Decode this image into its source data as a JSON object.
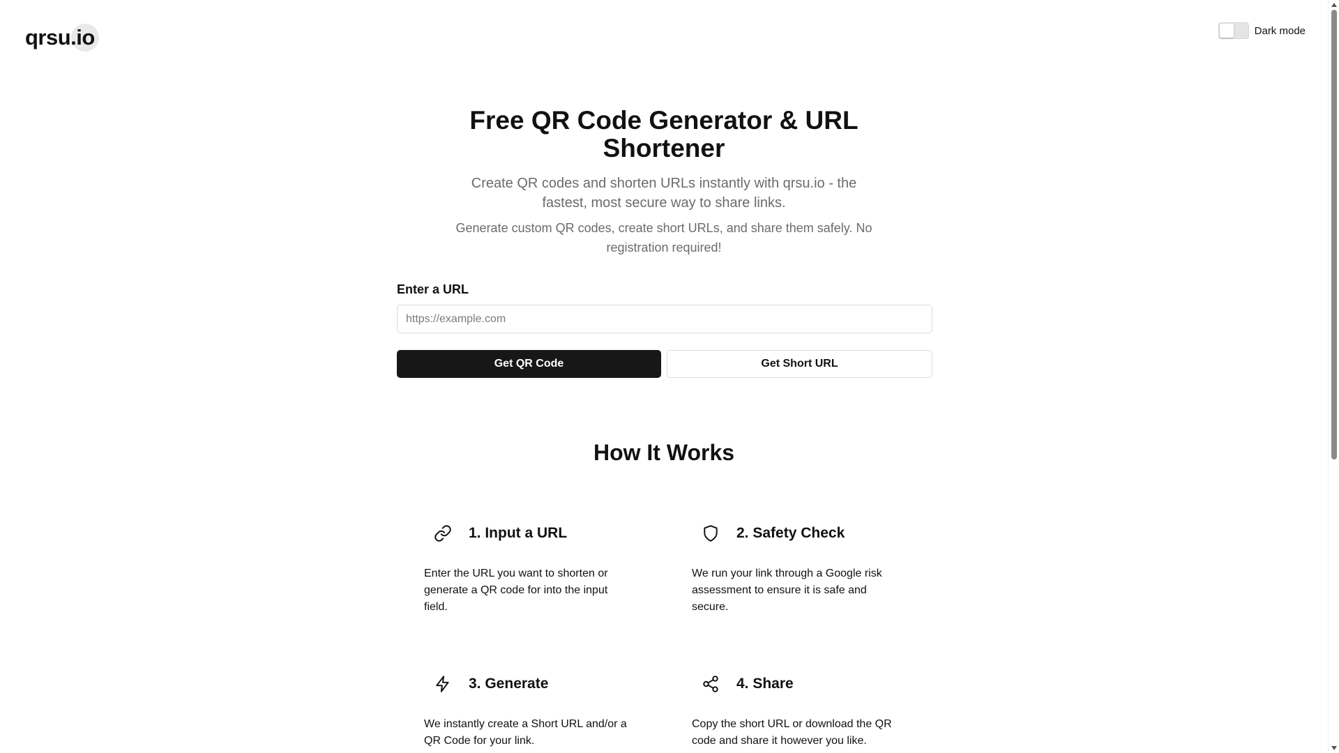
{
  "header": {
    "logo_text": "qrsu.io",
    "dark_mode_label": "Dark mode",
    "dark_mode_on": false
  },
  "hero": {
    "title": "Free QR Code Generator & URL Shortener",
    "subtitle": "Create QR codes and shorten URLs instantly with qrsu.io - the fastest, most secure way to share links.",
    "description": "Generate custom QR codes, create short URLs, and share them safely. No registration required!"
  },
  "form": {
    "label": "Enter a URL",
    "input_value": "",
    "input_placeholder": "https://example.com",
    "qr_button": "Get QR Code",
    "short_button": "Get Short URL"
  },
  "how_it_works": {
    "title": "How It Works",
    "steps": [
      {
        "icon": "link-icon",
        "title": "1. Input a URL",
        "description": "Enter the URL you want to shorten or generate a QR code for into the input field."
      },
      {
        "icon": "shield-icon",
        "title": "2. Safety Check",
        "description": "We run your link through a Google risk assessment to ensure it is safe and secure."
      },
      {
        "icon": "lightning-icon",
        "title": "3. Generate",
        "description": "We instantly create a Short URL and/or a QR Code for your link."
      },
      {
        "icon": "share-icon",
        "title": "4. Share",
        "description": "Copy the short URL or download the QR code and share it however you like."
      }
    ]
  },
  "colors": {
    "primary_button": "#171717",
    "muted_text": "#6b6b6b",
    "border": "#dcdcdc"
  }
}
